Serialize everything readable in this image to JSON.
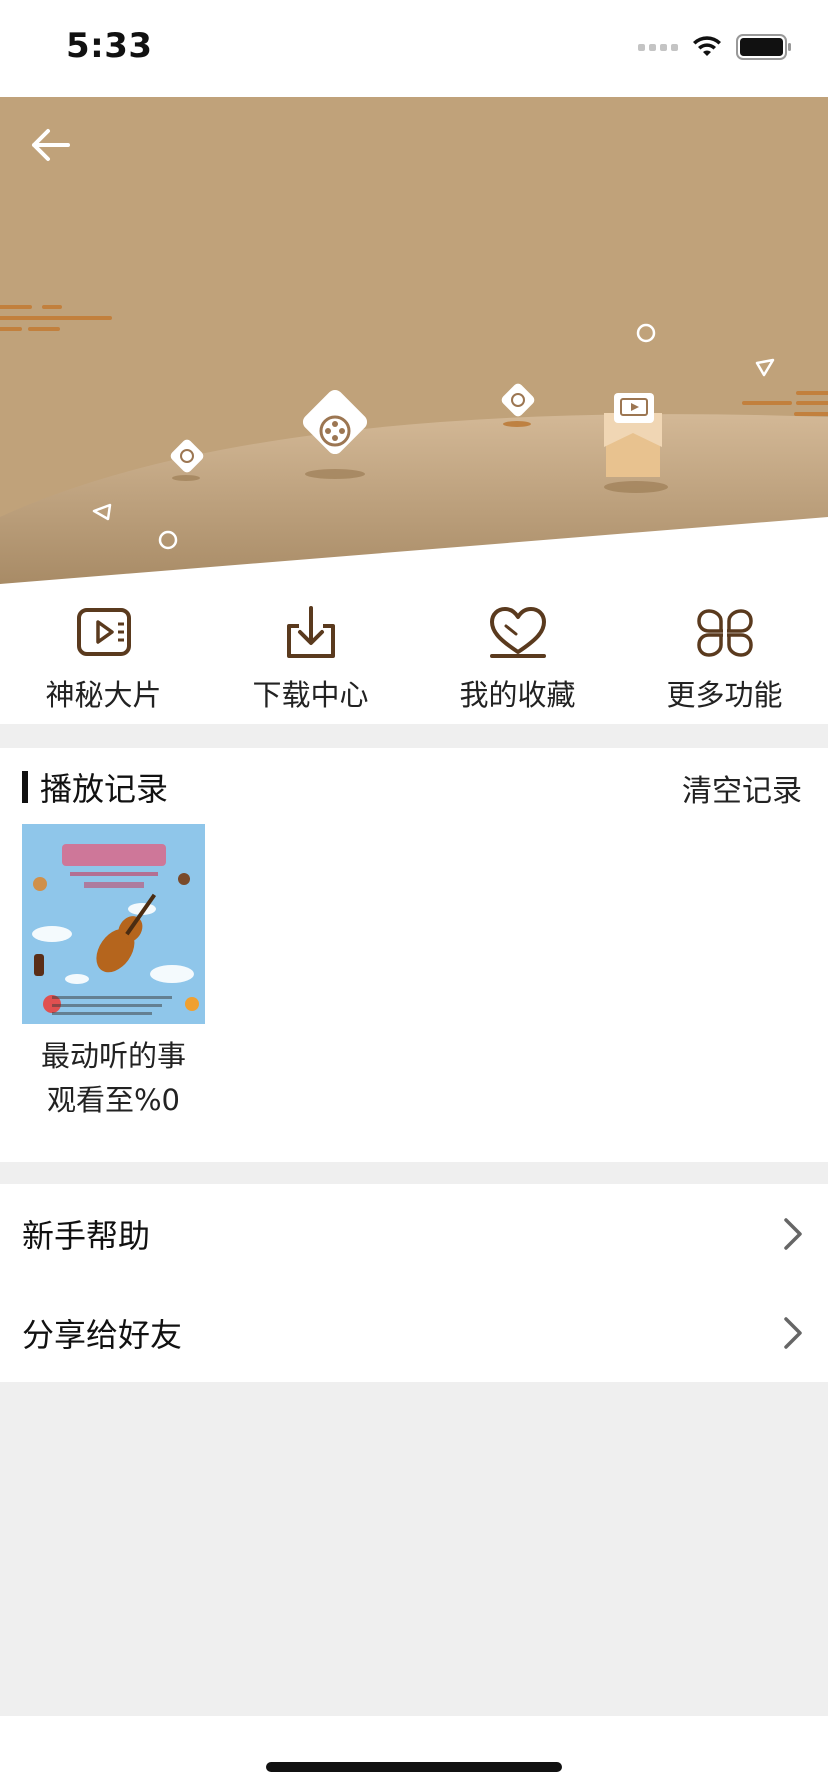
{
  "status_bar": {
    "time": "5:33"
  },
  "quick_menu": [
    {
      "label": "神秘大片",
      "icon": "play-screen-icon"
    },
    {
      "label": "下载中心",
      "icon": "download-icon"
    },
    {
      "label": "我的收藏",
      "icon": "heart-icon"
    },
    {
      "label": "更多功能",
      "icon": "clover-icon"
    }
  ],
  "history": {
    "title": "播放记录",
    "clear_label": "清空记录",
    "items": [
      {
        "title": "最动听的事",
        "progress": "观看至%0"
      }
    ]
  },
  "settings": [
    {
      "label": "新手帮助"
    },
    {
      "label": "分享给好友"
    }
  ],
  "colors": {
    "banner": "#c0a27a",
    "icon_brown": "#5a3a1e",
    "separator": "#efefef"
  }
}
